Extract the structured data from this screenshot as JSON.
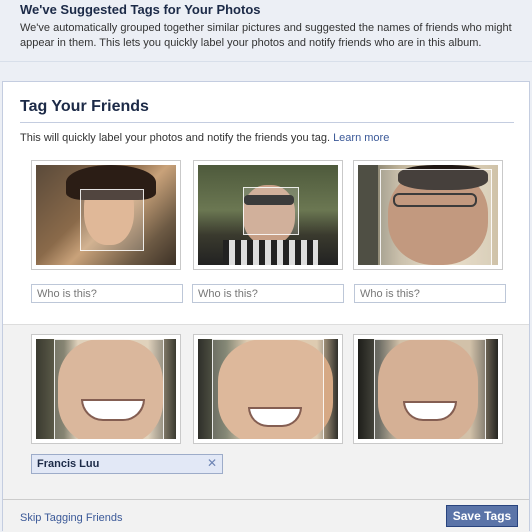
{
  "banner": {
    "title": "We've Suggested Tags for Your Photos",
    "text": "We've automatically grouped together similar pictures and suggested the names of friends who might appear in them. This lets you quickly label your photos and notify friends who are in this album."
  },
  "panel": {
    "title": "Tag Your Friends",
    "subtitle": "This will quickly label your photos and notify the friends you tag.",
    "learn_more": "Learn more"
  },
  "ungrouped": {
    "placeholders": [
      "Who is this?",
      "Who is this?",
      "Who is this?"
    ]
  },
  "grouped": {
    "name": "Francis Luu"
  },
  "footer": {
    "skip_label": "Skip Tagging Friends",
    "save_label": "Save Tags"
  },
  "colors": {
    "link": "#3b5998",
    "button": "#5b74a8",
    "banner_bg": "#eceff5"
  },
  "icons": {
    "remove": "close-icon"
  }
}
